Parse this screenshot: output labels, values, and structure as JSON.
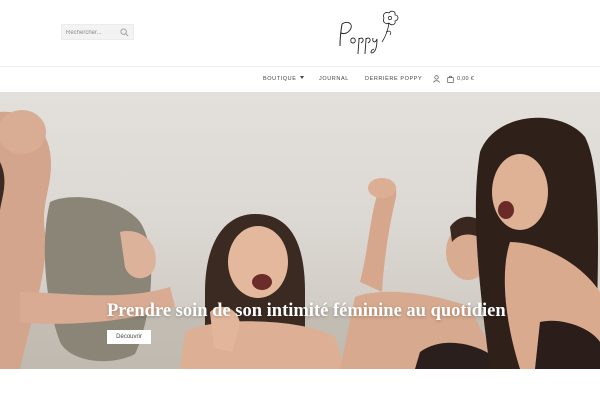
{
  "search": {
    "placeholder": "Rechercher..."
  },
  "logo": {
    "text": "Poppy"
  },
  "nav": {
    "items": [
      {
        "label": "Boutique"
      },
      {
        "label": "Journal"
      },
      {
        "label": "Derrière Poppy"
      }
    ],
    "cart_total": "0,00 €"
  },
  "hero": {
    "title": "Prendre soin de son intimité féminine au quotidien",
    "button_label": "Découvrir"
  },
  "colors": {
    "background": "#ffffff",
    "hero_wall": "#dcd8d3",
    "text": "#444444"
  },
  "icons": [
    "search-icon",
    "poppy-flower-logo",
    "caret-down-icon",
    "user-icon",
    "shopping-bag-icon"
  ]
}
